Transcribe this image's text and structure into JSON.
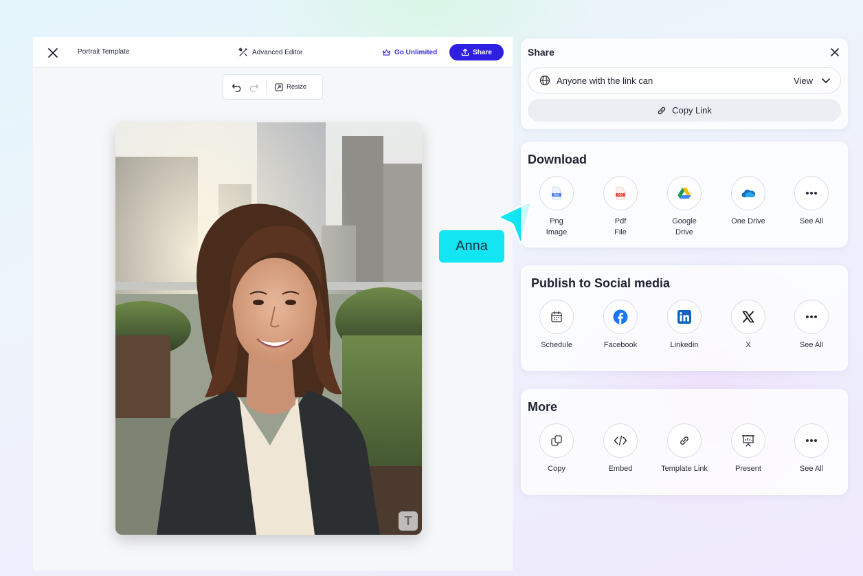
{
  "editor": {
    "doc_title": "Portrait Template",
    "advanced_editor_label": "Advanced Editor",
    "go_unlimited_label": "Go Unlimited",
    "share_label": "Share",
    "resize_label": "Resize",
    "watermark_letter": "T"
  },
  "collaborator": {
    "name": "Anna",
    "color": "#13e6f2"
  },
  "share": {
    "title": "Share",
    "access_text": "Anyone with the link can",
    "access_value": "View",
    "copy_link_label": "Copy Link"
  },
  "download": {
    "title": "Download",
    "items": [
      {
        "label": "Png\nImage",
        "icon": "png-file-icon"
      },
      {
        "label": "Pdf\nFile",
        "icon": "pdf-file-icon"
      },
      {
        "label": "Google\nDrive",
        "icon": "google-drive-icon"
      },
      {
        "label": "One Drive",
        "icon": "onedrive-icon"
      },
      {
        "label": "See All",
        "icon": "more-dots-icon"
      }
    ]
  },
  "social": {
    "title": "Publish to Social media",
    "items": [
      {
        "label": "Schedule",
        "icon": "calendar-icon"
      },
      {
        "label": "Facebook",
        "icon": "facebook-icon"
      },
      {
        "label": "Linkedin",
        "icon": "linkedin-icon"
      },
      {
        "label": "X",
        "icon": "x-icon"
      },
      {
        "label": "See All",
        "icon": "more-dots-icon"
      }
    ]
  },
  "more": {
    "title": "More",
    "items": [
      {
        "label": "Copy",
        "icon": "copy-icon"
      },
      {
        "label": "Embed",
        "icon": "code-icon"
      },
      {
        "label": "Template Link",
        "icon": "link-icon"
      },
      {
        "label": "Present",
        "icon": "presentation-icon"
      },
      {
        "label": "See All",
        "icon": "more-dots-icon"
      }
    ]
  },
  "colors": {
    "primary": "#2f1fe0",
    "go_unlimited": "#3b2fd8",
    "facebook": "#1877f2",
    "linkedin": "#0a66c2"
  }
}
